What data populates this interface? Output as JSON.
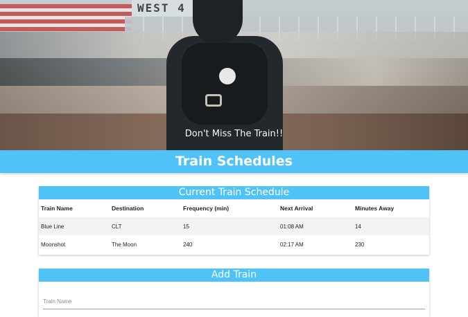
{
  "hero": {
    "sign_text": "WEST 4",
    "tagline": "Don't Miss The Train!!"
  },
  "page_title": "Train Schedules",
  "schedule": {
    "header": "Current Train Schedule",
    "columns": [
      "Train Name",
      "Destination",
      "Frequency (min)",
      "Next Arrival",
      "Minutes Away"
    ],
    "rows": [
      [
        "Blue Line",
        "CLT",
        "15",
        "01:08 AM",
        "14"
      ],
      [
        "Moonshot",
        "The Moon",
        "240",
        "02:17 AM",
        "230"
      ]
    ]
  },
  "add_train": {
    "header": "Add Train",
    "train_name_placeholder": "Train Name",
    "train_name_value": ""
  },
  "colors": {
    "accent": "#4fc3f7",
    "row_stripe": "#f2f2f2"
  }
}
